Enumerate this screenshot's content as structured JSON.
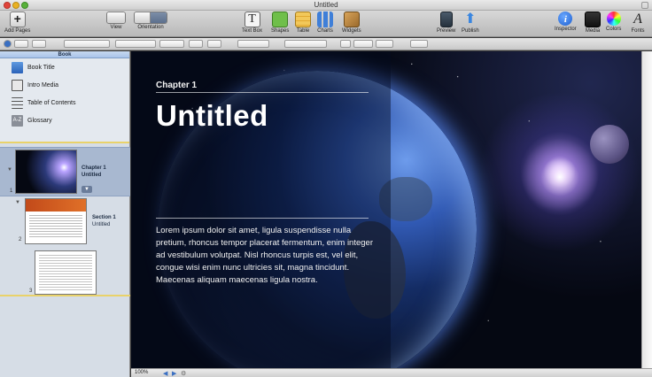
{
  "window": {
    "title": "Untitled"
  },
  "toolbar": {
    "add_pages": "Add Pages",
    "view": "View",
    "orientation": "Orientation",
    "text_box": "Text Box",
    "shapes": "Shapes",
    "table": "Table",
    "charts": "Charts",
    "widgets": "Widgets",
    "preview": "Preview",
    "publish": "Publish",
    "inspector": "Inspector",
    "media": "Media",
    "colors": "Colors",
    "fonts": "Fonts"
  },
  "sidebar": {
    "header": "Book",
    "items": [
      {
        "label": "Book Title",
        "icon": "book-icon"
      },
      {
        "label": "Intro Media",
        "icon": "intro-media-icon"
      },
      {
        "label": "Table of Contents",
        "icon": "toc-icon"
      },
      {
        "label": "Glossary",
        "icon": "glossary-icon"
      }
    ],
    "pages": [
      {
        "num": "1",
        "label_line1": "Chapter 1",
        "label_line2": "Untitled"
      },
      {
        "num": "2",
        "label_line1": "Section 1",
        "label_line2": "Untitled"
      },
      {
        "num": "3"
      }
    ],
    "glossary_icon_text": "A-Z"
  },
  "canvas": {
    "chapter": "Chapter 1",
    "title": "Untitled",
    "body": "Lorem ipsum dolor sit amet, ligula suspendisse nulla pretium, rhoncus tempor placerat fermentum, enim integer ad vestibulum volutpat. Nisl rhoncus turpis est, vel elit, congue wisi enim nunc ultricies sit, magna tincidunt. Maecenas aliquam maecenas ligula nostra."
  },
  "status": {
    "zoom": "100%"
  },
  "colors": {
    "accent": "#3a6fc2",
    "selection": "#a8b8d0",
    "divider": "#e9d26a"
  }
}
